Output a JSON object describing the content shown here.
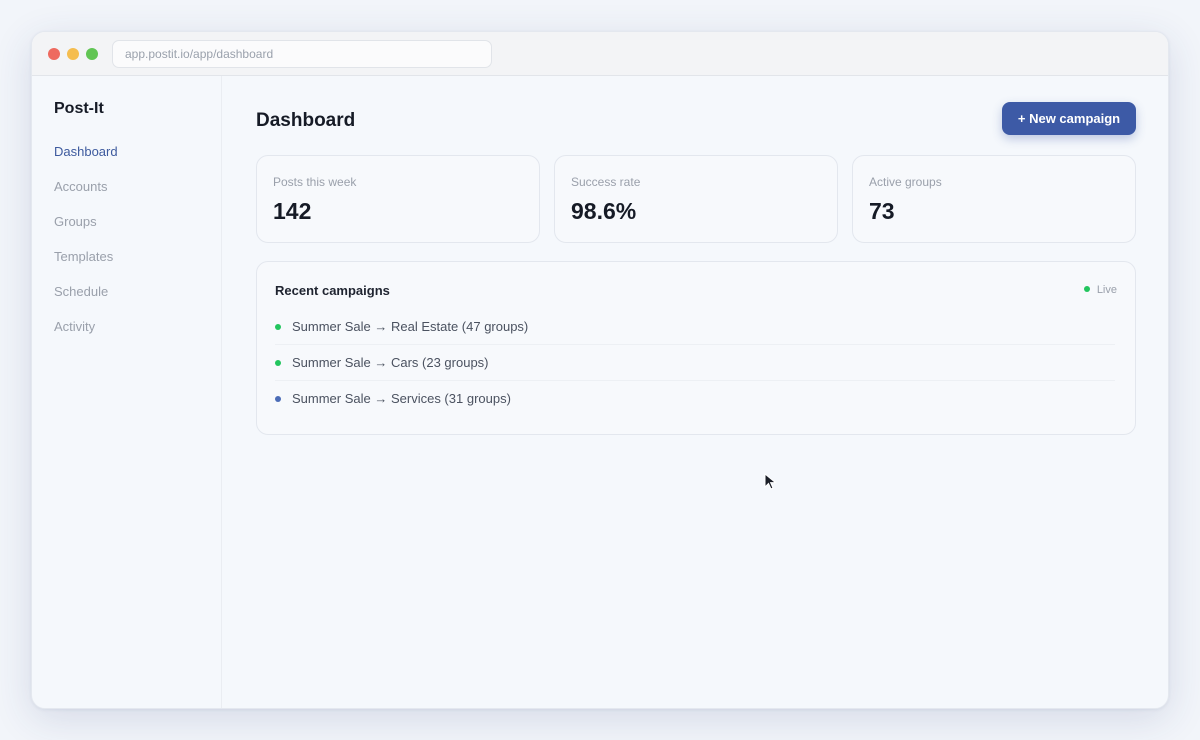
{
  "browser": {
    "url": "app.postit.io/app/dashboard"
  },
  "sidebar": {
    "brand": "Post-It",
    "items": [
      {
        "label": "Dashboard",
        "active": true
      },
      {
        "label": "Accounts",
        "active": false
      },
      {
        "label": "Groups",
        "active": false
      },
      {
        "label": "Templates",
        "active": false
      },
      {
        "label": "Schedule",
        "active": false
      },
      {
        "label": "Activity",
        "active": false
      }
    ]
  },
  "header": {
    "title": "Dashboard",
    "new_button": "+ New campaign"
  },
  "stats": [
    {
      "label": "Posts this week",
      "value": "142"
    },
    {
      "label": "Success rate",
      "value": "98.6%"
    },
    {
      "label": "Active groups",
      "value": "73"
    }
  ],
  "recent": {
    "title": "Recent campaigns",
    "live_label": "Live",
    "items": [
      {
        "text": "Summer Sale → Real Estate (47 groups)",
        "status_color": "#22c55e"
      },
      {
        "text": "Summer Sale → Cars (23 groups)",
        "status_color": "#22c55e"
      },
      {
        "text": "Summer Sale → Services (31 groups)",
        "status_color": "#4b6cb7"
      }
    ]
  },
  "colors": {
    "accent": "#3d5aa6",
    "live": "#22c55e"
  }
}
